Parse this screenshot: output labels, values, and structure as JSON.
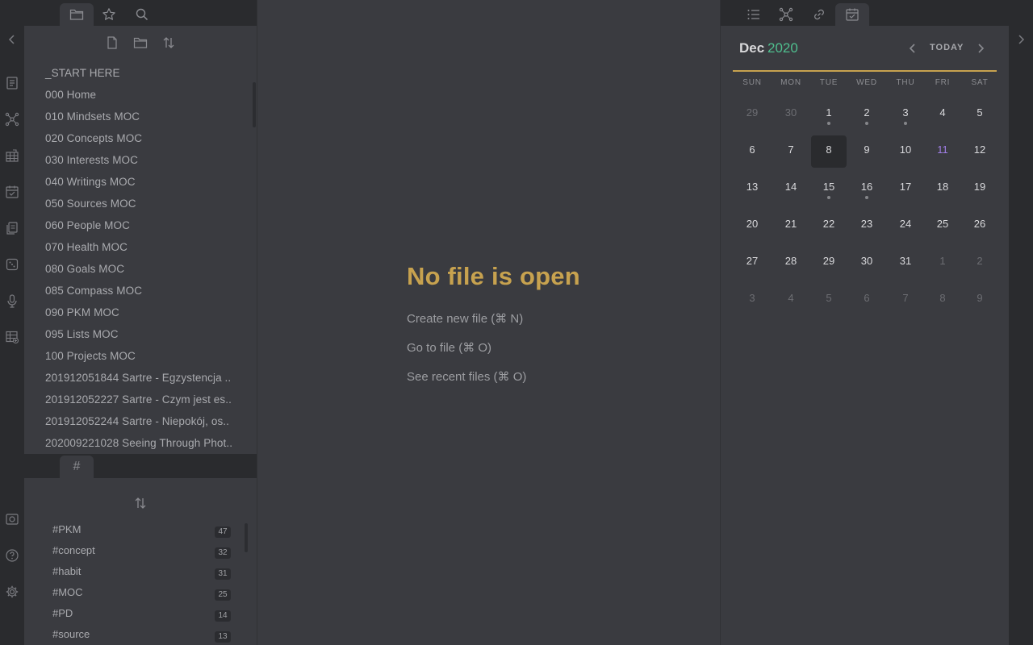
{
  "left_sidebar": {
    "tabs": [
      {
        "name": "file-explorer",
        "icon": "folder-icon"
      },
      {
        "name": "starred",
        "icon": "star-icon"
      },
      {
        "name": "search",
        "icon": "search-icon"
      }
    ],
    "files": [
      "_START HERE",
      "000 Home",
      "010 Mindsets MOC",
      "020 Concepts MOC",
      "030 Interests MOC",
      "040 Writings MOC",
      "050 Sources MOC",
      "060 People MOC",
      "070 Health MOC",
      "080 Goals MOC",
      "085 Compass MOC",
      "090 PKM MOC",
      "095 Lists MOC",
      "100 Projects MOC",
      "201912051844 Sartre - Egzystencja ..",
      "201912052227 Sartre - Czym jest es..",
      "201912052244 Sartre - Niepokój, os..",
      "202009221028 Seeing Through Phot.."
    ],
    "tag_tab_symbol": "#",
    "tags": [
      {
        "label": "#PKM",
        "count": "47"
      },
      {
        "label": "#concept",
        "count": "32"
      },
      {
        "label": "#habit",
        "count": "31"
      },
      {
        "label": "#MOC",
        "count": "25"
      },
      {
        "label": "#PD",
        "count": "14"
      },
      {
        "label": "#source",
        "count": "13"
      }
    ]
  },
  "main": {
    "title": "No file is open",
    "actions": [
      "Create new file (⌘ N)",
      "Go to file (⌘ O)",
      "See recent files (⌘ O)"
    ]
  },
  "calendar": {
    "month": "Dec",
    "year": "2020",
    "today_label": "TODAY",
    "weekdays": [
      "SUN",
      "MON",
      "TUE",
      "WED",
      "THU",
      "FRI",
      "SAT"
    ],
    "weeks": [
      [
        {
          "d": "29",
          "faded": true
        },
        {
          "d": "30",
          "faded": true
        },
        {
          "d": "1",
          "dot": true
        },
        {
          "d": "2",
          "dot": true
        },
        {
          "d": "3",
          "dot": true
        },
        {
          "d": "4"
        },
        {
          "d": "5"
        }
      ],
      [
        {
          "d": "6"
        },
        {
          "d": "7"
        },
        {
          "d": "8",
          "active": true
        },
        {
          "d": "9"
        },
        {
          "d": "10"
        },
        {
          "d": "11",
          "today": true
        },
        {
          "d": "12"
        }
      ],
      [
        {
          "d": "13"
        },
        {
          "d": "14"
        },
        {
          "d": "15",
          "dot": true
        },
        {
          "d": "16",
          "dot": true
        },
        {
          "d": "17"
        },
        {
          "d": "18"
        },
        {
          "d": "19"
        }
      ],
      [
        {
          "d": "20"
        },
        {
          "d": "21"
        },
        {
          "d": "22"
        },
        {
          "d": "23"
        },
        {
          "d": "24"
        },
        {
          "d": "25"
        },
        {
          "d": "26"
        }
      ],
      [
        {
          "d": "27"
        },
        {
          "d": "28"
        },
        {
          "d": "29"
        },
        {
          "d": "30"
        },
        {
          "d": "31"
        },
        {
          "d": "1",
          "faded": true
        },
        {
          "d": "2",
          "faded": true
        }
      ],
      [
        {
          "d": "3",
          "faded": true
        },
        {
          "d": "4",
          "faded": true
        },
        {
          "d": "5",
          "faded": true
        },
        {
          "d": "6",
          "faded": true
        },
        {
          "d": "7",
          "faded": true
        },
        {
          "d": "8",
          "faded": true
        },
        {
          "d": "9",
          "faded": true
        }
      ]
    ],
    "colors": {
      "accent": "#c7a24f",
      "year": "#4fbf8f",
      "today": "#a07ee6"
    }
  }
}
